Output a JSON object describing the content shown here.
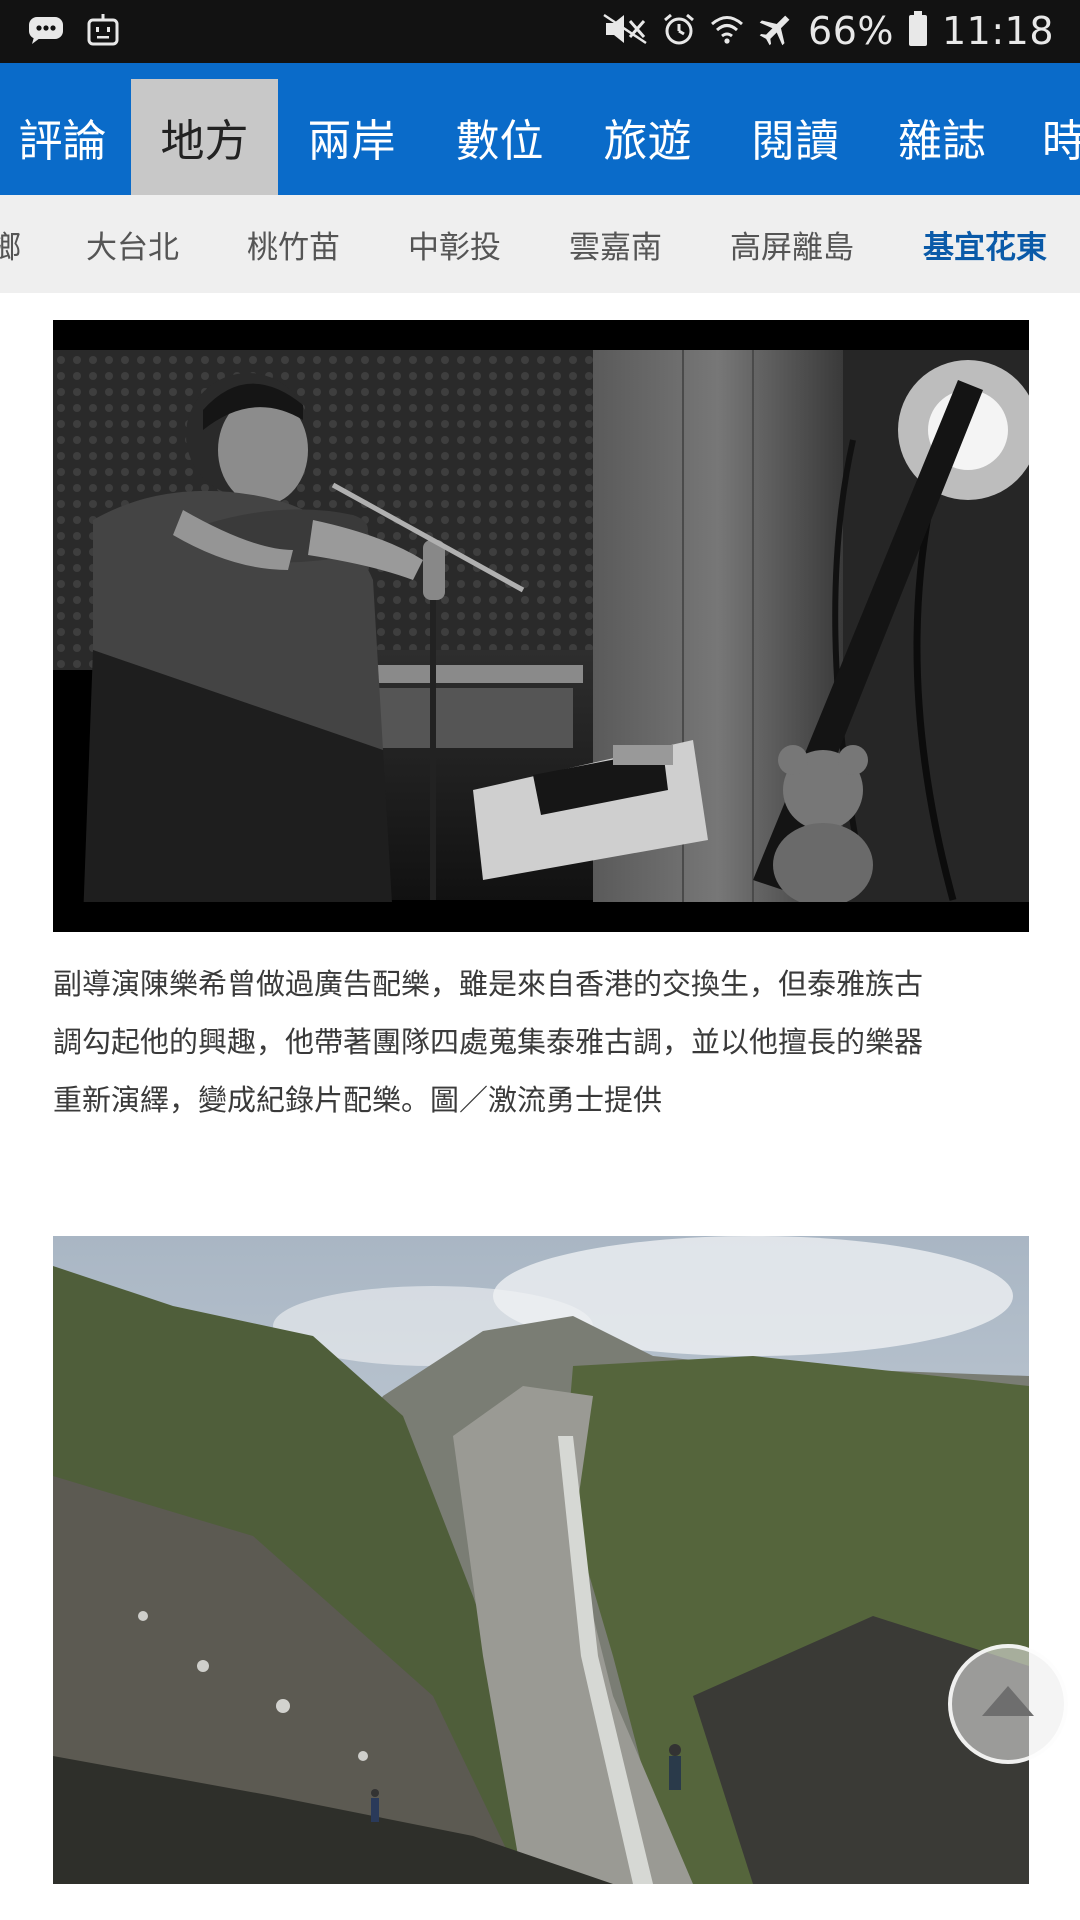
{
  "status_bar": {
    "battery": "66%",
    "time": "11:18",
    "icons": [
      "chat-bubble-icon",
      "robot-icon",
      "mute-icon",
      "alarm-icon",
      "wifi-icon",
      "airplane-icon",
      "battery-icon"
    ]
  },
  "main_nav": {
    "tabs": [
      {
        "label": "評論"
      },
      {
        "label": "地方",
        "active": true
      },
      {
        "label": "兩岸"
      },
      {
        "label": "數位"
      },
      {
        "label": "旅遊"
      },
      {
        "label": "閱讀"
      },
      {
        "label": "雜誌"
      },
      {
        "label": "時"
      }
    ]
  },
  "sub_nav": {
    "items": [
      {
        "label": "鄉"
      },
      {
        "label": "大台北"
      },
      {
        "label": "桃竹苗"
      },
      {
        "label": "中彰投"
      },
      {
        "label": "雲嘉南"
      },
      {
        "label": "高屏離島"
      },
      {
        "label": "基宜花東",
        "active": true
      }
    ]
  },
  "article": {
    "caption_lines": [
      "副導演陳樂希曾做過廣告配樂，雖是來自香港的交換生，但泰雅族古",
      "調勾起他的興趣，他帶著團隊四處蒐集泰雅古調，並以他擅長的樂器",
      "重新演繹，變成紀錄片配樂。圖／激流勇士提供"
    ]
  },
  "colors": {
    "nav_blue": "#0a6bc9",
    "active_tab_bg": "#c8c8c8",
    "subnav_bg": "#efefef",
    "subnav_active": "#0a5aa8"
  }
}
